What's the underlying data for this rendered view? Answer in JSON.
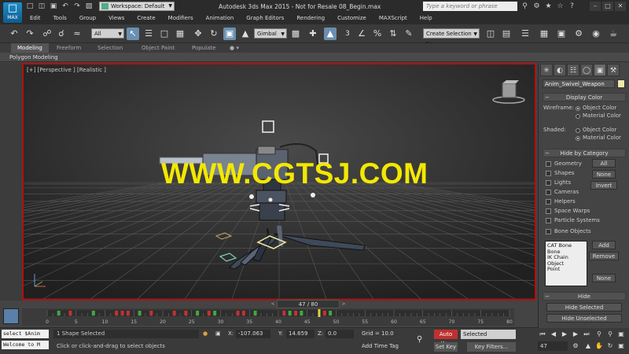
{
  "app": {
    "logo_text": "MAX",
    "title": "Autodesk 3ds Max  2015  - Not for Resale   08_Begin.max",
    "workspace_label": "Workspace: Default",
    "search_placeholder": "Type a keyword or phrase"
  },
  "menu": [
    "Edit",
    "Tools",
    "Group",
    "Views",
    "Create",
    "Modifiers",
    "Animation",
    "Graph Editors",
    "Rendering",
    "Customize",
    "MAXScript",
    "Help"
  ],
  "toolbar": {
    "selection_filter": "All",
    "ref_coord": "Gimbal",
    "selection_set": "Create Selection Se",
    "snap_label": "3"
  },
  "ribbon": {
    "tabs": [
      "Modeling",
      "Freeform",
      "Selection",
      "Object Paint",
      "Populate"
    ],
    "active_tab": "Modeling",
    "sub_label": "Polygon Modeling"
  },
  "viewport": {
    "label": "[+] [Perspective ] [Realistic ]",
    "watermark": "WWW.CGTSJ.COM",
    "border_color": "#b20f0f",
    "watermark_color": "#f3e800"
  },
  "command_panel": {
    "object_name": "Anim_Swivel_Weapon",
    "object_color": "#efe8a8",
    "display_color": {
      "title": "Display Color",
      "wireframe_label": "Wireframe:",
      "shaded_label": "Shaded:",
      "option_object": "Object Color",
      "option_material": "Material Color",
      "wireframe_selected": "Object Color",
      "shaded_selected": "Material Color"
    },
    "hide_by_category": {
      "title": "Hide by Category",
      "items": [
        "Geometry",
        "Shapes",
        "Lights",
        "Cameras",
        "Helpers",
        "Space Warps",
        "Particle Systems",
        "Bone Objects"
      ],
      "btn_all": "All",
      "btn_none": "None",
      "btn_invert": "Invert",
      "list": [
        "CAT Bone",
        "Bone",
        "IK Chain Object",
        "Point"
      ],
      "btn_add": "Add",
      "btn_remove": "Remove",
      "btn_list_none": "None"
    },
    "hide": {
      "title": "Hide",
      "btn_hide_selected": "Hide Selected",
      "btn_hide_unselected": "Hide Unselected"
    }
  },
  "timeline": {
    "slider_text": "47 / 80",
    "current": 47,
    "total": 80,
    "ticks": [
      0,
      5,
      10,
      15,
      20,
      25,
      30,
      35,
      40,
      45,
      50,
      55,
      60,
      65,
      70,
      75,
      80
    ],
    "keys_red": [
      4,
      12,
      13,
      14,
      18,
      22,
      24,
      28,
      33,
      34,
      41,
      43,
      48
    ],
    "keys_green": [
      2,
      8,
      16,
      26,
      29,
      36,
      42,
      44,
      49
    ],
    "key_labels": [
      "6",
      "13",
      "17",
      "23",
      "43",
      "47"
    ]
  },
  "status": {
    "script_line1": "select $Anim",
    "script_line2": "Welcome to M",
    "selection_info": "1 Shape Selected",
    "prompt": "Click or click-and-drag to select objects",
    "x_label": "X:",
    "x_value": "-107.063",
    "y_label": "Y:",
    "y_value": "14.659",
    "z_label": "Z:",
    "z_value": "0.0",
    "grid": "Grid = 10.0",
    "add_time_tag": "Add Time Tag",
    "auto_key": "Auto Key",
    "set_key": "Set Key",
    "key_mode": "Selected",
    "key_filters": "Key Filters...",
    "frame": "47"
  }
}
